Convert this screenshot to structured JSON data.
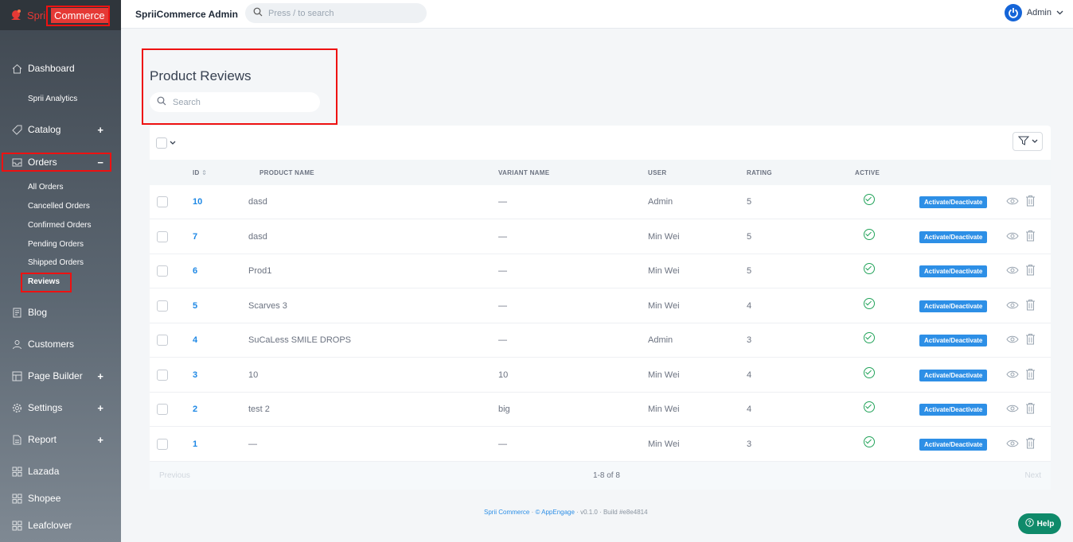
{
  "brand": {
    "part1": "Sprii",
    "part2": "Commerce"
  },
  "topbar": {
    "title": "SpriiCommerce Admin",
    "search_placeholder": "Press / to search",
    "user": "Admin"
  },
  "sidebar": {
    "dashboard": "Dashboard",
    "analytics": "Sprii Analytics",
    "catalog": "Catalog",
    "orders": "Orders",
    "orders_toggle": "−",
    "plus": "+",
    "sub_orders": [
      "All Orders",
      "Cancelled Orders",
      "Confirmed Orders",
      "Pending Orders",
      "Shipped Orders",
      "Reviews"
    ],
    "blog": "Blog",
    "customers": "Customers",
    "page_builder": "Page Builder",
    "settings": "Settings",
    "report": "Report",
    "lazada": "Lazada",
    "shopee": "Shopee",
    "leafclover": "Leafclover"
  },
  "page": {
    "title": "Product Reviews",
    "search_placeholder": "Search"
  },
  "table": {
    "headers": {
      "id": "ID",
      "product": "PRODUCT NAME",
      "variant": "VARIANT NAME",
      "user": "USER",
      "rating": "RATING",
      "active": "ACTIVE"
    },
    "action_label": "Activate/Deactivate",
    "rows": [
      {
        "id": "10",
        "product": "dasd",
        "variant": "—",
        "user": "Admin",
        "rating": "5"
      },
      {
        "id": "7",
        "product": "dasd",
        "variant": "—",
        "user": "Min Wei",
        "rating": "5"
      },
      {
        "id": "6",
        "product": "Prod1",
        "variant": "—",
        "user": "Min Wei",
        "rating": "5"
      },
      {
        "id": "5",
        "product": "Scarves 3",
        "variant": "—",
        "user": "Min Wei",
        "rating": "4"
      },
      {
        "id": "4",
        "product": "SuCaLess SMILE DROPS",
        "variant": "—",
        "user": "Admin",
        "rating": "3"
      },
      {
        "id": "3",
        "product": "10",
        "variant": "10",
        "user": "Min Wei",
        "rating": "4"
      },
      {
        "id": "2",
        "product": "test 2",
        "variant": "big",
        "user": "Min Wei",
        "rating": "4"
      },
      {
        "id": "1",
        "product": "—",
        "variant": "—",
        "user": "Min Wei",
        "rating": "3"
      }
    ]
  },
  "pager": {
    "prev": "Previous",
    "info": "1-8 of 8",
    "next": "Next"
  },
  "footer": {
    "brand": "Sprii Commerce",
    "company": "© AppEngage",
    "version": "v0.1.0",
    "build": "Build #e8e4814"
  },
  "help": "Help",
  "colors": {
    "accent": "#2d8fe6",
    "highlight": "#ee1111",
    "active": "#22a35a",
    "brand_red": "#e53935"
  }
}
